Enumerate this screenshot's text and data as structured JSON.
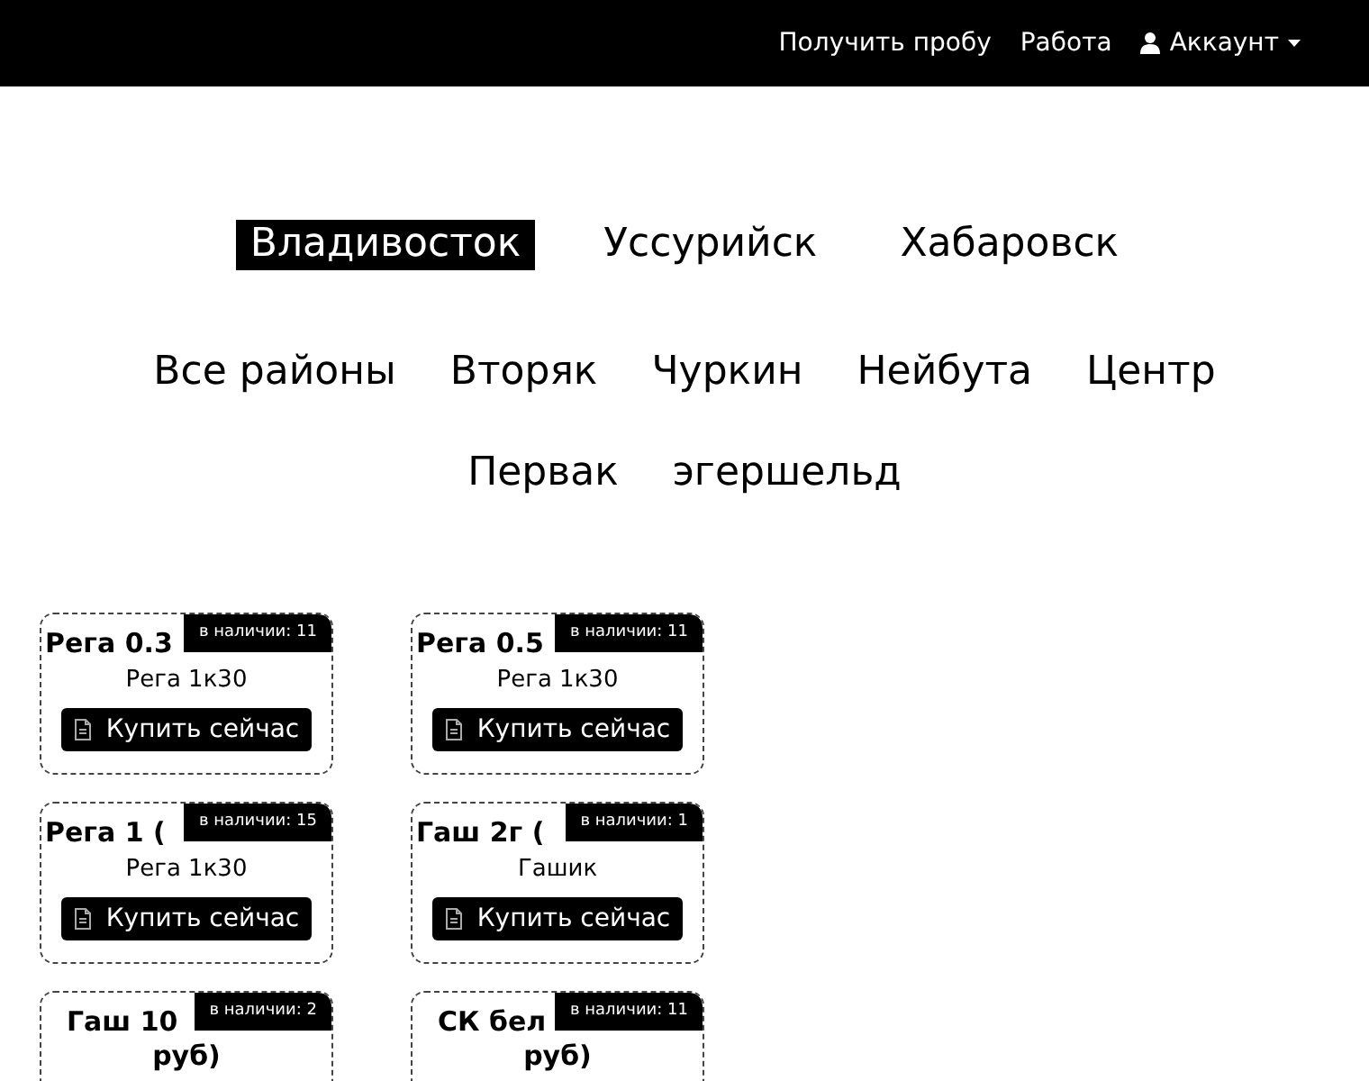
{
  "navbar": {
    "links": [
      {
        "label": "Получить пробу",
        "kind": "link"
      },
      {
        "label": "Работа",
        "kind": "link"
      },
      {
        "label": "Аккаунт",
        "kind": "account"
      }
    ]
  },
  "cities": [
    {
      "label": "Владивосток",
      "selected": true
    },
    {
      "label": "Уссурийск",
      "selected": false
    },
    {
      "label": "Хабаровск",
      "selected": false
    }
  ],
  "districts": [
    [
      "Все районы",
      "Вторяк",
      "Чуркин",
      "Нейбута",
      "Центр"
    ],
    [
      "Первак",
      "эгершельд"
    ]
  ],
  "products": [
    {
      "title": "Рега 0.3",
      "subtitle": "Рега 1к30",
      "stock": "в наличии: 11",
      "button": "Купить сейчас"
    },
    {
      "title": "Рега 0.5",
      "subtitle": "Рега 1к30",
      "stock": "в наличии: 11",
      "button": "Купить сейчас"
    },
    {
      "title": "Рега 1 (",
      "subtitle": "Рега 1к30",
      "stock": "в наличии: 15",
      "button": "Купить сейчас"
    },
    {
      "title": "Гаш 2г (",
      "subtitle": "Гашик",
      "stock": "в наличии: 1",
      "button": "Купить сейчас"
    },
    {
      "title": "Гаш 10",
      "title_line2": "руб)",
      "stock": "в наличии: 2"
    },
    {
      "title": "СК бел",
      "title_line2": "руб)",
      "stock": "в наличии: 11"
    }
  ]
}
